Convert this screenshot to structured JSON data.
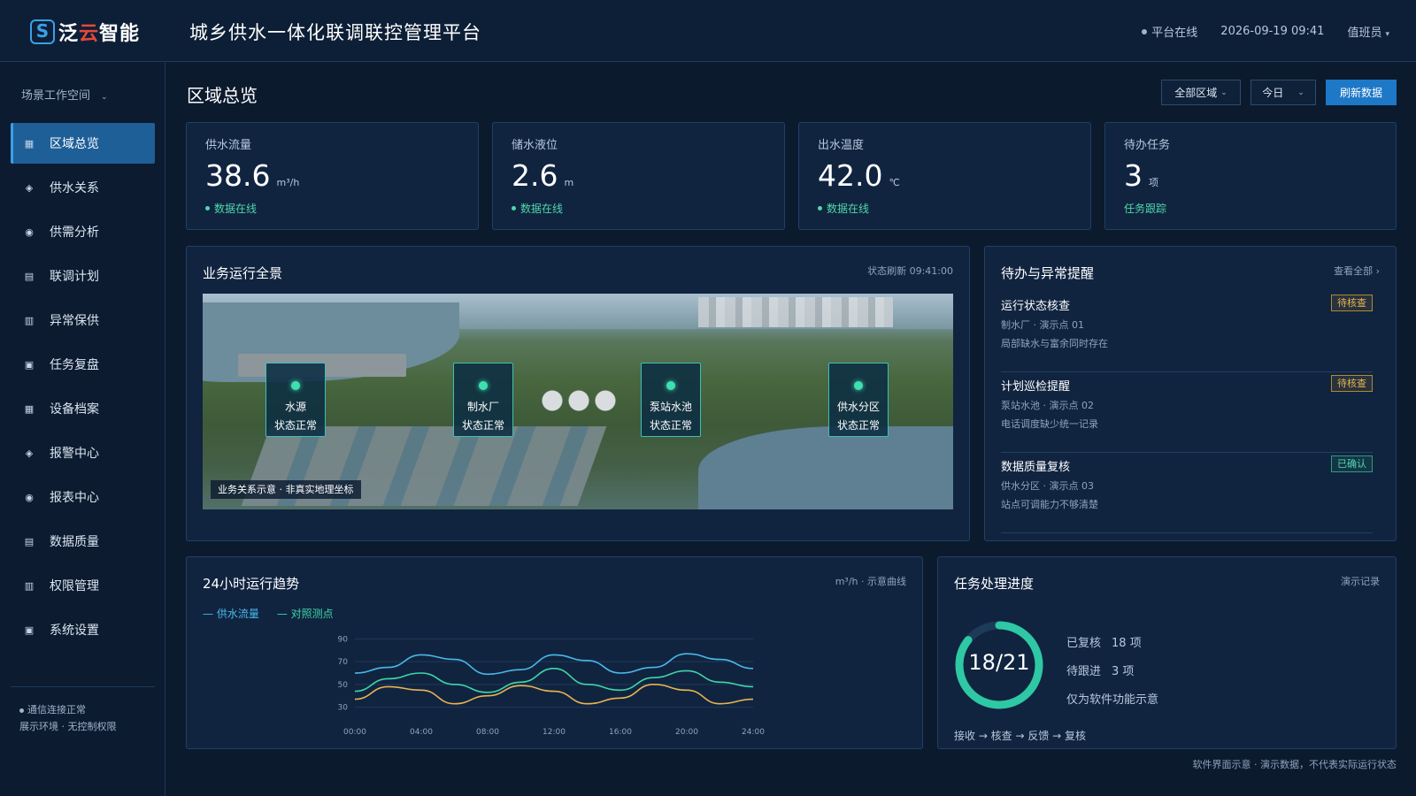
{
  "header": {
    "logo_mark": "S",
    "logo_text_a": "泛",
    "logo_text_b": "云",
    "logo_text_c": "智能",
    "title": "城乡供水一体化联调联控管理平台",
    "status": "平台在线",
    "datetime": "2026-09-19 09:41",
    "user": "值班员"
  },
  "sidebar": {
    "workspace": "场景工作空间",
    "items": [
      {
        "label": "区域总览",
        "icon": "grid-icon",
        "glyph": "▦"
      },
      {
        "label": "供水关系",
        "icon": "diamond-icon",
        "glyph": "◈"
      },
      {
        "label": "供需分析",
        "icon": "target-icon",
        "glyph": "◉"
      },
      {
        "label": "联调计划",
        "icon": "list-icon",
        "glyph": "▤"
      },
      {
        "label": "异常保供",
        "icon": "table-icon",
        "glyph": "▥"
      },
      {
        "label": "任务复盘",
        "icon": "square-icon",
        "glyph": "▣"
      },
      {
        "label": "设备档案",
        "icon": "grid-icon",
        "glyph": "▦"
      },
      {
        "label": "报警中心",
        "icon": "diamond-icon",
        "glyph": "◈"
      },
      {
        "label": "报表中心",
        "icon": "target-icon",
        "glyph": "◉"
      },
      {
        "label": "数据质量",
        "icon": "list-icon",
        "glyph": "▤"
      },
      {
        "label": "权限管理",
        "icon": "table-icon",
        "glyph": "▥"
      },
      {
        "label": "系统设置",
        "icon": "square-icon",
        "glyph": "▣"
      }
    ],
    "status_line1": "通信连接正常",
    "status_line2": "展示环境 · 无控制权限"
  },
  "main": {
    "title": "区域总览",
    "filter_region": "全部区域",
    "filter_date": "今日",
    "refresh_label": "刷新数据"
  },
  "stats": [
    {
      "label": "供水流量",
      "value": "38.6",
      "unit": "m³/h",
      "foot": "数据在线"
    },
    {
      "label": "储水液位",
      "value": "2.6",
      "unit": "m",
      "foot": "数据在线"
    },
    {
      "label": "出水温度",
      "value": "42.0",
      "unit": "℃",
      "foot": "数据在线"
    },
    {
      "label": "待办任务",
      "value": "3",
      "unit": "项",
      "foot": "任务跟踪"
    }
  ],
  "overview": {
    "title": "业务运行全景",
    "meta": "状态刷新 09:41:00",
    "nodes": [
      {
        "name": "水源",
        "state": "状态正常"
      },
      {
        "name": "制水厂",
        "state": "状态正常"
      },
      {
        "name": "泵站水池",
        "state": "状态正常"
      },
      {
        "name": "供水分区",
        "state": "状态正常"
      }
    ],
    "caption": "业务关系示意 · 非真实地理坐标"
  },
  "alerts": {
    "title": "待办与异常提醒",
    "view_all": "查看全部 ›",
    "items": [
      {
        "title": "运行状态核查",
        "sub": "制水厂 · 演示点 01",
        "desc": "局部缺水与富余同时存在",
        "tag": "待核查",
        "tag_type": "pending"
      },
      {
        "title": "计划巡检提醒",
        "sub": "泵站水池 · 演示点 02",
        "desc": "电话调度缺少统一记录",
        "tag": "待核查",
        "tag_type": "pending"
      },
      {
        "title": "数据质量复核",
        "sub": "供水分区 · 演示点 03",
        "desc": "站点可调能力不够清楚",
        "tag": "已确认",
        "tag_type": "done"
      }
    ]
  },
  "trend": {
    "title": "24小时运行趋势",
    "meta": "m³/h · 示意曲线",
    "legend_a": "— 供水流量",
    "legend_b": "— 对照测点"
  },
  "chart_data": {
    "type": "line",
    "x": [
      "00:00",
      "02:00",
      "04:00",
      "06:00",
      "08:00",
      "10:00",
      "12:00",
      "14:00",
      "16:00",
      "18:00",
      "20:00",
      "22:00",
      "24:00"
    ],
    "x_ticks": [
      "00:00",
      "04:00",
      "08:00",
      "12:00",
      "16:00",
      "20:00",
      "24:00"
    ],
    "y_ticks": [
      90,
      70,
      50,
      30
    ],
    "ylim": [
      25,
      95
    ],
    "grid": true,
    "series": [
      {
        "name": "供水流量",
        "color": "#4ab8e8",
        "values": [
          60,
          65,
          76,
          72,
          59,
          63,
          76,
          71,
          60,
          65,
          77,
          72,
          64
        ]
      },
      {
        "name": "对照测点",
        "color": "#3fd6a8",
        "values": [
          44,
          55,
          60,
          50,
          43,
          52,
          64,
          50,
          45,
          56,
          62,
          52,
          48
        ]
      },
      {
        "color": "#e8b450",
        "values": [
          37,
          48,
          45,
          33,
          40,
          49,
          44,
          33,
          38,
          50,
          45,
          33,
          37
        ]
      }
    ]
  },
  "progress": {
    "title": "任务处理进度",
    "meta": "演示记录",
    "ratio_text": "18/21",
    "done": 18,
    "total": 21,
    "line1_label": "已复核",
    "line1_value": "18 项",
    "line2_label": "待跟进",
    "line2_value": "3 项",
    "line3": "仅为软件功能示意",
    "flow": "接收 → 核查 → 反馈 → 复核"
  },
  "footnote": "软件界面示意 · 演示数据，不代表实际运行状态"
}
